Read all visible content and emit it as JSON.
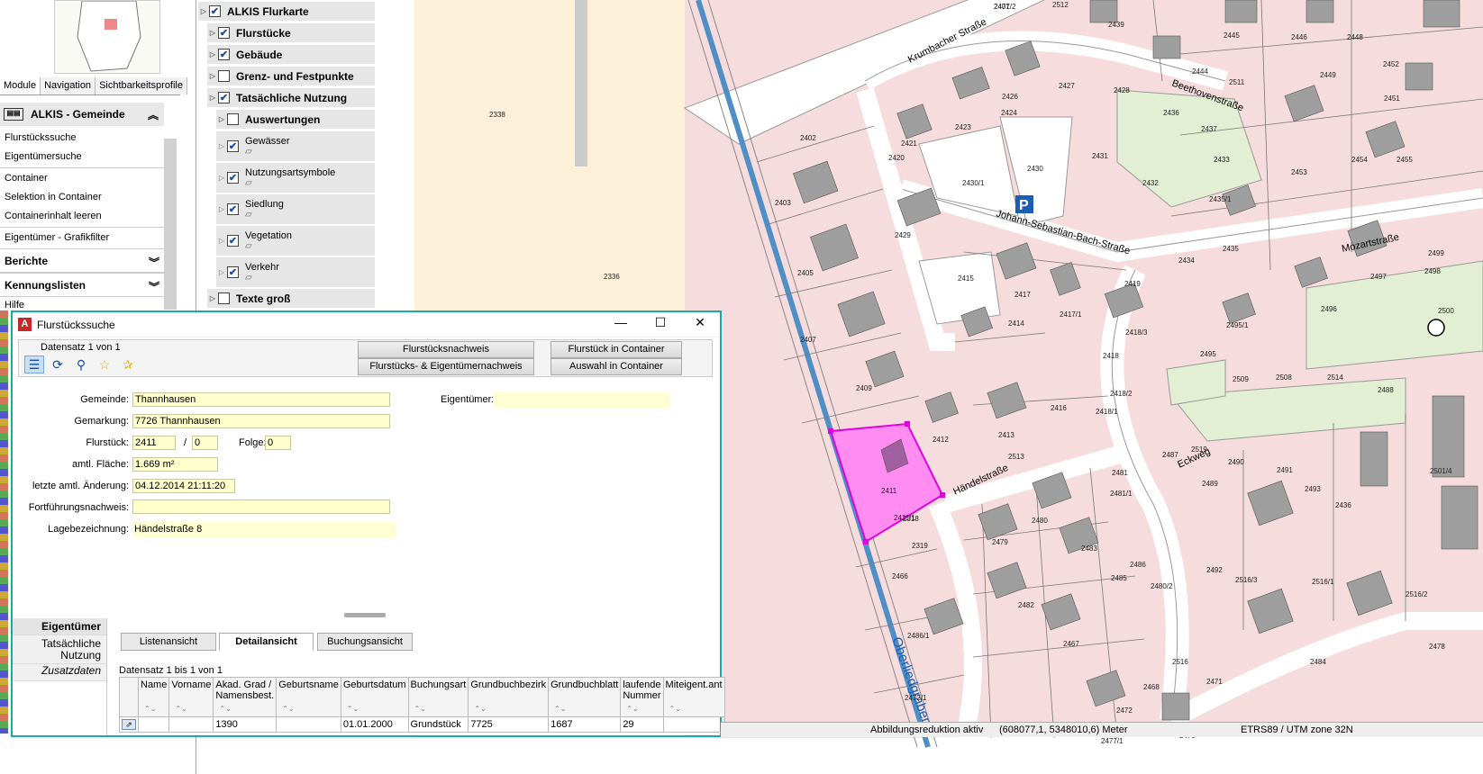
{
  "window": {
    "title": "Flurstückssuche"
  },
  "left_panel": {
    "tabs": [
      "Module",
      "Navigation",
      "Sichtbarkeitsprofile"
    ],
    "module_header": "ALKIS - Gemeinde",
    "items": [
      "Flurstückssuche",
      "Eigentümersuche",
      "Container",
      "Selektion in Container",
      "Containerinhalt leeren",
      "Eigentümer - Grafikfilter"
    ],
    "sections": [
      "Berichte",
      "Kennungslisten"
    ],
    "last_item": "Hilfe"
  },
  "layers": [
    {
      "label": "ALKIS Flurkarte",
      "checked": true,
      "bold": true
    },
    {
      "label": "Flurstücke",
      "checked": true,
      "bold": true
    },
    {
      "label": "Gebäude",
      "checked": true,
      "bold": true
    },
    {
      "label": "Grenz- und Festpunkte",
      "checked": false,
      "bold": true
    },
    {
      "label": "Tatsächliche Nutzung",
      "checked": true,
      "bold": true
    },
    {
      "label": "Auswertungen",
      "checked": false,
      "bold": true
    },
    {
      "label": "Gewässer",
      "checked": true,
      "bold": false
    },
    {
      "label": "Nutzungsartsymbole",
      "checked": true,
      "bold": false
    },
    {
      "label": "Siedlung",
      "checked": true,
      "bold": false
    },
    {
      "label": "Vegetation",
      "checked": true,
      "bold": false
    },
    {
      "label": "Verkehr",
      "checked": true,
      "bold": false
    },
    {
      "label": "Texte groß",
      "checked": false,
      "bold": true
    }
  ],
  "dialog": {
    "record": "Datensatz 1 von 1",
    "buttons": {
      "flurstuecksnachweis": "Flurstücksnachweis",
      "flurstuecks_eigentuemernachweis": "Flurstücks- & Eigentümernachweis",
      "flurstueck_in_container": "Flurstück in Container",
      "auswahl_in_container": "Auswahl in Container"
    },
    "fields": {
      "gemeinde_label": "Gemeinde:",
      "gemeinde": "Thannhausen",
      "gemarkung_label": "Gemarkung:",
      "gemarkung": "7726 Thannhausen",
      "flurstueck_label": "Flurstück:",
      "flurstueck": "2411",
      "slash": "/",
      "nenner": "0",
      "folge_label": "Folge:",
      "folge": "0",
      "flaeche_label": "amtl. Fläche:",
      "flaeche": "1.669 m²",
      "aenderung_label": "letzte amtl. Änderung:",
      "aenderung": "04.12.2014 21:11:20",
      "fortfuehrung_label": "Fortführungsnachweis:",
      "fortfuehrung": "",
      "lage_label": "Lagebezeichnung:",
      "lage": "Händelstraße 8",
      "eigentuemer_label": "Eigentümer:",
      "eigentuemer": ""
    },
    "lower_nav": [
      "Eigentümer",
      "Tatsächliche Nutzung",
      "Zusatzdaten"
    ],
    "subtabs": [
      "Listenansicht",
      "Detailansicht",
      "Buchungsansicht"
    ],
    "table_count": "Datensatz 1 bis 1 von 1",
    "table_headers": [
      "",
      "Name",
      "Vorname",
      "Akad. Grad / Namensbest.",
      "Geburtsname",
      "Geburtsdatum",
      "Buchungsart",
      "Grundbuchbezirk",
      "Grundbuchblatt",
      "laufende Nummer",
      "Miteigent.ant"
    ],
    "table_row": [
      "",
      "",
      "",
      "1390",
      "",
      "01.01.2000",
      "Grundstück",
      "7725",
      "1687",
      "29",
      ""
    ]
  },
  "status": {
    "reduction": "Abbildungsreduktion aktiv",
    "coords": "(608077,1, 5348010,6) Meter",
    "crs": "ETRS89 / UTM zone 32N"
  },
  "map": {
    "streets": [
      "Krumbacher Straße",
      "Beethovenstraße",
      "Johann-Sebastian-Bach-Straße",
      "Mozartstraße",
      "Händelstraße",
      "Eckweg",
      "Oberliedgraben"
    ],
    "parcel_labels": [
      "2401",
      "2512",
      "2439",
      "2445",
      "2446",
      "2448",
      "2444",
      "2511",
      "2449",
      "2452",
      "2338",
      "2426",
      "2427",
      "2428",
      "2436",
      "2437",
      "2451",
      "2402",
      "2421",
      "2423",
      "2424",
      "2430",
      "2431",
      "2433",
      "2453",
      "2454",
      "2455",
      "2403",
      "2420",
      "2430/1",
      "2432",
      "2435/1",
      "2429",
      "2434",
      "2435",
      "2499",
      "2336",
      "2405",
      "2415",
      "2417",
      "2419",
      "2417/1",
      "2497",
      "2498",
      "2496",
      "2500",
      "2407",
      "2414",
      "2495/1",
      "2418",
      "2418/3",
      "2495",
      "2409",
      "2418/2",
      "2509",
      "2508",
      "2514",
      "2488",
      "2416",
      "2418/1",
      "2412",
      "2413",
      "2487",
      "2519",
      "2490",
      "2491",
      "2501/4",
      "2411",
      "2513",
      "2489",
      "2493",
      "2481",
      "2481/1",
      "2318",
      "2319",
      "2411/1",
      "2480",
      "2436",
      "2479",
      "2483",
      "2492",
      "2516/3",
      "2516/1",
      "2516/2",
      "2466",
      "2485",
      "2486",
      "2480/2",
      "2482",
      "2486/1",
      "2467",
      "2484",
      "2478",
      "2516",
      "2472/1",
      "2468",
      "2472",
      "2471",
      "2477/1",
      "2470",
      "2477/2"
    ],
    "colors": {
      "residential": "#f6dcdc",
      "farmland": "#fdf0d8",
      "green": "#e2efd2",
      "building": "#9e9e9e",
      "selected": "#ff8cf0",
      "selected_stroke": "#e000e0",
      "water": "#4f8fc5",
      "dialog_border": "#1aaba4"
    }
  }
}
